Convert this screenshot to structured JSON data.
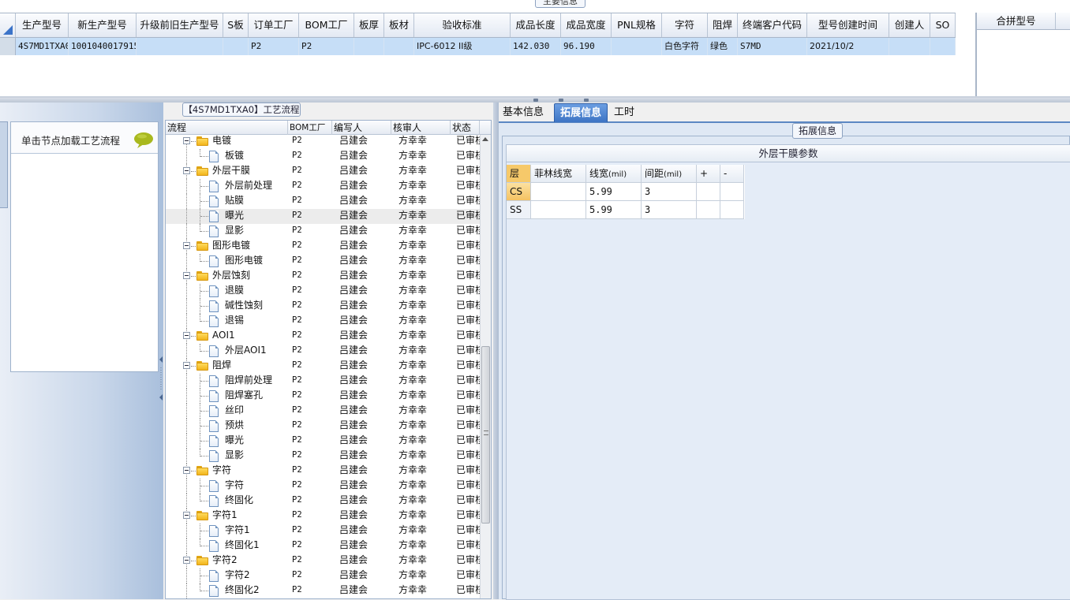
{
  "main_info": {
    "title": "主要信息",
    "columns": [
      "生产型号",
      "新生产型号",
      "升级前旧生产型号",
      "S板",
      "订单工厂",
      "BOM工厂",
      "板厚",
      "板材",
      "验收标准",
      "成品长度",
      "成品宽度",
      "PNL规格",
      "字符",
      "阻焊",
      "终端客户代码",
      "型号创建时间",
      "创建人",
      "SO"
    ],
    "row": [
      "4S7MD1TXA0",
      "10010400179159",
      "",
      "",
      "P2",
      "P2",
      "",
      "",
      "IPC-6012 II级",
      "142.030",
      "96.190",
      "",
      "白色字符",
      "绿色",
      "S7MD",
      "2021/10/2",
      "",
      ""
    ],
    "merge_header": "合拼型号"
  },
  "left_panel": {
    "load_hint": "单击节点加载工艺流程",
    "chat_icon": "speech-bubble-icon"
  },
  "process": {
    "title": "【4S7MD1TXA0】工艺流程",
    "columns": [
      "流程",
      "BOM工厂",
      "编写人",
      "核审人",
      "状态"
    ],
    "rows": [
      {
        "name": "电镀",
        "type": "folder",
        "bom": "P2",
        "writer": "吕建会",
        "reviewer": "方幸幸",
        "status": "已审核"
      },
      {
        "name": "板镀",
        "type": "leaf",
        "bom": "P2",
        "writer": "吕建会",
        "reviewer": "方幸幸",
        "status": "已审核"
      },
      {
        "name": "外层干膜",
        "type": "folder",
        "bom": "P2",
        "writer": "吕建会",
        "reviewer": "方幸幸",
        "status": "已审核"
      },
      {
        "name": "外层前处理",
        "type": "leaf",
        "bom": "P2",
        "writer": "吕建会",
        "reviewer": "方幸幸",
        "status": "已审核"
      },
      {
        "name": "贴膜",
        "type": "leaf",
        "bom": "P2",
        "writer": "吕建会",
        "reviewer": "方幸幸",
        "status": "已审核"
      },
      {
        "name": "曝光",
        "type": "leaf",
        "bom": "P2",
        "writer": "吕建会",
        "reviewer": "方幸幸",
        "status": "已审核",
        "selected": true
      },
      {
        "name": "显影",
        "type": "leaf",
        "bom": "P2",
        "writer": "吕建会",
        "reviewer": "方幸幸",
        "status": "已审核"
      },
      {
        "name": "图形电镀",
        "type": "folder",
        "bom": "P2",
        "writer": "吕建会",
        "reviewer": "方幸幸",
        "status": "已审核"
      },
      {
        "name": "图形电镀",
        "type": "leaf",
        "bom": "P2",
        "writer": "吕建会",
        "reviewer": "方幸幸",
        "status": "已审核"
      },
      {
        "name": "外层蚀刻",
        "type": "folder",
        "bom": "P2",
        "writer": "吕建会",
        "reviewer": "方幸幸",
        "status": "已审核"
      },
      {
        "name": "退膜",
        "type": "leaf",
        "bom": "P2",
        "writer": "吕建会",
        "reviewer": "方幸幸",
        "status": "已审核"
      },
      {
        "name": "碱性蚀刻",
        "type": "leaf",
        "bom": "P2",
        "writer": "吕建会",
        "reviewer": "方幸幸",
        "status": "已审核"
      },
      {
        "name": "退锡",
        "type": "leaf",
        "bom": "P2",
        "writer": "吕建会",
        "reviewer": "方幸幸",
        "status": "已审核"
      },
      {
        "name": "AOI1",
        "type": "folder",
        "bom": "P2",
        "writer": "吕建会",
        "reviewer": "方幸幸",
        "status": "已审核"
      },
      {
        "name": "外层AOI1",
        "type": "leaf",
        "bom": "P2",
        "writer": "吕建会",
        "reviewer": "方幸幸",
        "status": "已审核"
      },
      {
        "name": "阻焊",
        "type": "folder",
        "bom": "P2",
        "writer": "吕建会",
        "reviewer": "方幸幸",
        "status": "已审核"
      },
      {
        "name": "阻焊前处理",
        "type": "leaf",
        "bom": "P2",
        "writer": "吕建会",
        "reviewer": "方幸幸",
        "status": "已审核"
      },
      {
        "name": "阻焊塞孔",
        "type": "leaf",
        "bom": "P2",
        "writer": "吕建会",
        "reviewer": "方幸幸",
        "status": "已审核"
      },
      {
        "name": "丝印",
        "type": "leaf",
        "bom": "P2",
        "writer": "吕建会",
        "reviewer": "方幸幸",
        "status": "已审核"
      },
      {
        "name": "预烘",
        "type": "leaf",
        "bom": "P2",
        "writer": "吕建会",
        "reviewer": "方幸幸",
        "status": "已审核"
      },
      {
        "name": "曝光",
        "type": "leaf",
        "bom": "P2",
        "writer": "吕建会",
        "reviewer": "方幸幸",
        "status": "已审核"
      },
      {
        "name": "显影",
        "type": "leaf",
        "bom": "P2",
        "writer": "吕建会",
        "reviewer": "方幸幸",
        "status": "已审核"
      },
      {
        "name": "字符",
        "type": "folder",
        "bom": "P2",
        "writer": "吕建会",
        "reviewer": "方幸幸",
        "status": "已审核"
      },
      {
        "name": "字符",
        "type": "leaf",
        "bom": "P2",
        "writer": "吕建会",
        "reviewer": "方幸幸",
        "status": "已审核"
      },
      {
        "name": "终固化",
        "type": "leaf",
        "bom": "P2",
        "writer": "吕建会",
        "reviewer": "方幸幸",
        "status": "已审核"
      },
      {
        "name": "字符1",
        "type": "folder",
        "bom": "P2",
        "writer": "吕建会",
        "reviewer": "方幸幸",
        "status": "已审核"
      },
      {
        "name": "字符1",
        "type": "leaf",
        "bom": "P2",
        "writer": "吕建会",
        "reviewer": "方幸幸",
        "status": "已审核"
      },
      {
        "name": "终固化1",
        "type": "leaf",
        "bom": "P2",
        "writer": "吕建会",
        "reviewer": "方幸幸",
        "status": "已审核"
      },
      {
        "name": "字符2",
        "type": "folder",
        "bom": "P2",
        "writer": "吕建会",
        "reviewer": "方幸幸",
        "status": "已审核"
      },
      {
        "name": "字符2",
        "type": "leaf",
        "bom": "P2",
        "writer": "吕建会",
        "reviewer": "方幸幸",
        "status": "已审核"
      },
      {
        "name": "终固化2",
        "type": "leaf",
        "bom": "P2",
        "writer": "吕建会",
        "reviewer": "方幸幸",
        "status": "已审核"
      }
    ]
  },
  "detail_tabs": [
    {
      "label": "基本信息",
      "active": false
    },
    {
      "label": "拓展信息",
      "active": true
    },
    {
      "label": "工时",
      "active": false
    }
  ],
  "ext_info": {
    "title": "拓展信息",
    "film_title": "外层干膜参数",
    "columns": [
      "层",
      "菲林线宽",
      "线宽",
      "(mil)",
      "间距",
      "(mil)",
      "+",
      "-"
    ],
    "rows": [
      {
        "layer": "CS",
        "phil": "",
        "line_width": "5.99",
        "spacing": "3",
        "active": true
      },
      {
        "layer": "SS",
        "phil": "",
        "line_width": "5.99",
        "spacing": "3",
        "active": false
      }
    ]
  },
  "colors": {
    "selected_row": "#c6def7",
    "active_tab": "#3d74c4",
    "folder": "#f2b51c",
    "layer_header": "#f6c96a"
  }
}
